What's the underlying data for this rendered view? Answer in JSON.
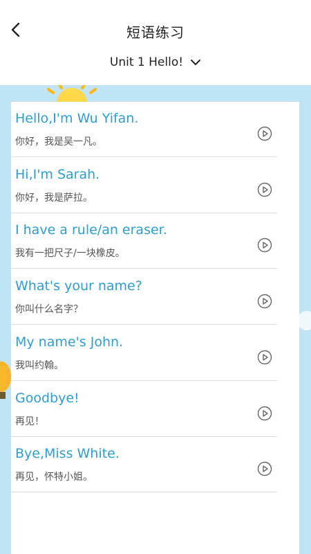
{
  "header": {
    "title": "短语练习",
    "unit": "Unit 1 Hello!"
  },
  "phrases": [
    {
      "en": "Hello,I'm Wu Yifan.",
      "zh": "你好，我是吴一凡。"
    },
    {
      "en": "Hi,I'm Sarah.",
      "zh": "你好，我是萨拉。"
    },
    {
      "en": "I have a rule/an eraser.",
      "zh": "我有一把尺子/一块橡皮。"
    },
    {
      "en": "What's your name?",
      "zh": "你叫什么名字？"
    },
    {
      "en": "My name's John.",
      "zh": "我叫约翰。"
    },
    {
      "en": "Goodbye!",
      "zh": "再见！"
    },
    {
      "en": "Bye,Miss White.",
      "zh": "再见，怀特小姐。"
    }
  ],
  "icons": {
    "back": "chevron-left-icon",
    "dropdown": "chevron-down-icon",
    "play": "play-circle-icon"
  },
  "colors": {
    "accent": "#2a9fd6",
    "background": "#bfe4f5"
  }
}
